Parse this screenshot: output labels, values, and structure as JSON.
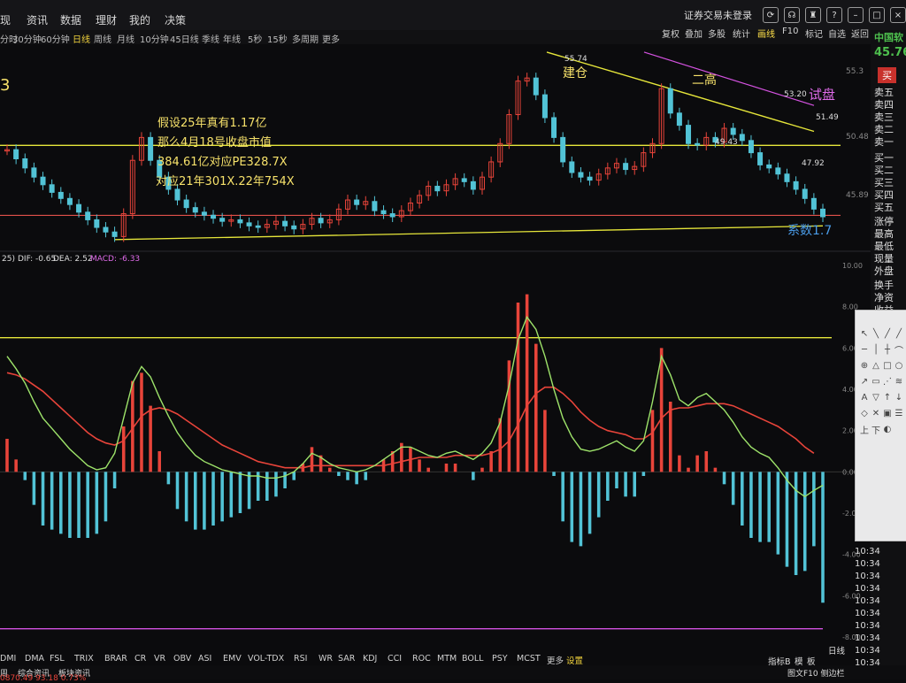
{
  "top_menu": [
    "现",
    "资讯",
    "数据",
    "理财",
    "我的",
    "决策"
  ],
  "top_right": {
    "login": "证券交易未登录",
    "icons": [
      "refresh-icon",
      "headset-icon",
      "shirt-icon",
      "help-icon",
      "minimize-icon",
      "restore-icon",
      "close-icon"
    ]
  },
  "periods": [
    "分时",
    "30分钟",
    "60分钟",
    "日线",
    "周线",
    "月线",
    "10分钟",
    "45日线",
    "季线",
    "年线",
    "5秒",
    "15秒",
    "多周期",
    "更多"
  ],
  "active_period": "日线",
  "right_tools": [
    "复权",
    "叠加",
    "多股",
    "统计",
    "画线",
    "F10",
    "标记",
    "自选",
    "返回"
  ],
  "right_tools_active": "画线",
  "stock": {
    "name": "中国软",
    "price": "45.76",
    "buy_label": "买"
  },
  "order_book": [
    "卖五",
    "卖四",
    "卖三",
    "卖二",
    "卖一",
    "买一",
    "买二",
    "买三",
    "买四",
    "买五"
  ],
  "quote_fields": [
    "涨停",
    "最高",
    "最低",
    "现量",
    "外盘",
    "换手",
    "净资",
    "收益"
  ],
  "price_axis": [
    "55.3",
    "50.48",
    "45.89"
  ],
  "macd_axis": [
    "10.00",
    "8.00",
    "6.00",
    "4.00",
    "2.00",
    "0.00",
    "-2.00",
    "-4.00",
    "-6.00",
    "-8.00"
  ],
  "macd_header": {
    "param": "25)",
    "dif": "DIF: -0.65",
    "dea": "DEA: 2.52",
    "macd": "MACD: -6.33"
  },
  "annotations": {
    "left_number": "3",
    "block": [
      "假设25年真有1.17亿",
      "那么4月18号收盘市值",
      "384.61亿对应PE328.7X",
      "对应21年301X.22年754X"
    ],
    "jiancang": "建仓",
    "ergao": "二高",
    "shipan": "试盘",
    "xishu": "系数1.7",
    "price_peak": "55.74",
    "price_5320": "53.20",
    "price_5149": "51.49",
    "price_4792": "47.92",
    "price_4943": "49.43"
  },
  "chart_data": {
    "type": "line",
    "title": "",
    "candles_close": [
      50.2,
      49.6,
      49.0,
      48.4,
      47.9,
      47.4,
      47.0,
      46.6,
      46.1,
      45.6,
      45.1,
      44.8,
      44.5,
      46.0,
      49.5,
      51.0,
      49.5,
      48.4,
      47.6,
      46.9,
      46.4,
      46.1,
      45.9,
      45.7,
      45.5,
      45.6,
      45.4,
      45.2,
      45.1,
      45.3,
      45.5,
      45.2,
      45.0,
      45.3,
      45.7,
      45.4,
      45.6,
      46.3,
      46.9,
      46.6,
      46.8,
      46.2,
      46.0,
      45.8,
      46.2,
      46.7,
      47.2,
      47.8,
      47.5,
      47.9,
      48.3,
      48.1,
      47.6,
      48.4,
      49.4,
      50.6,
      52.5,
      54.7,
      54.9,
      53.8,
      52.3,
      51.0,
      49.4,
      48.7,
      48.4,
      48.2,
      48.6,
      49.0,
      49.3,
      48.9,
      49.1,
      50.0,
      50.6,
      54.2,
      52.6,
      51.8,
      50.6,
      50.5,
      51.0,
      50.7,
      51.6,
      51.2,
      50.8,
      50.0,
      49.2,
      49.0,
      48.6,
      48.1,
      47.6,
      47.0,
      46.3,
      45.8
    ],
    "macd_dif": [
      5.6,
      5.0,
      4.3,
      3.4,
      2.6,
      2.1,
      1.6,
      1.1,
      0.7,
      0.3,
      0.1,
      0.2,
      0.9,
      2.6,
      4.3,
      5.1,
      4.6,
      3.6,
      2.7,
      1.9,
      1.3,
      0.8,
      0.5,
      0.3,
      0.1,
      0.0,
      -0.1,
      -0.2,
      -0.2,
      -0.3,
      -0.3,
      -0.2,
      0.0,
      0.4,
      0.9,
      0.7,
      0.4,
      0.2,
      0.1,
      0.0,
      0.1,
      0.3,
      0.6,
      0.9,
      1.2,
      1.2,
      1.0,
      0.8,
      0.7,
      0.9,
      1.0,
      0.8,
      0.6,
      0.9,
      1.4,
      2.4,
      4.2,
      6.4,
      7.5,
      6.9,
      5.6,
      4.0,
      2.6,
      1.7,
      1.1,
      1.0,
      1.1,
      1.3,
      1.5,
      1.2,
      1.0,
      1.5,
      3.4,
      5.6,
      4.7,
      3.5,
      3.2,
      3.6,
      3.8,
      3.4,
      3.0,
      2.4,
      1.7,
      1.2,
      0.9,
      0.7,
      0.2,
      -0.4,
      -0.9,
      -1.2,
      -0.9,
      -0.65
    ],
    "macd_dea": [
      4.8,
      4.7,
      4.5,
      4.2,
      3.9,
      3.5,
      3.1,
      2.7,
      2.3,
      1.9,
      1.6,
      1.4,
      1.3,
      1.5,
      2.1,
      2.7,
      3.0,
      3.1,
      3.0,
      2.8,
      2.5,
      2.2,
      1.9,
      1.6,
      1.3,
      1.1,
      0.9,
      0.7,
      0.5,
      0.4,
      0.3,
      0.2,
      0.2,
      0.2,
      0.3,
      0.3,
      0.3,
      0.3,
      0.3,
      0.3,
      0.3,
      0.3,
      0.3,
      0.4,
      0.5,
      0.6,
      0.7,
      0.7,
      0.7,
      0.7,
      0.8,
      0.8,
      0.8,
      0.8,
      0.9,
      1.1,
      1.5,
      2.3,
      3.2,
      3.8,
      4.1,
      4.1,
      3.8,
      3.4,
      2.9,
      2.5,
      2.2,
      2.0,
      1.9,
      1.8,
      1.6,
      1.6,
      1.9,
      2.6,
      3.0,
      3.1,
      3.1,
      3.2,
      3.3,
      3.3,
      3.3,
      3.2,
      3.0,
      2.8,
      2.6,
      2.4,
      2.2,
      1.9,
      1.6,
      1.2,
      0.9,
      2.52
    ],
    "ylim_price": [
      44,
      57
    ],
    "ylim_macd": [
      -8,
      10
    ]
  },
  "indicators": [
    "DMI",
    "DMA",
    "FSL",
    "TRIX",
    "BRAR",
    "CR",
    "VR",
    "OBV",
    "ASI",
    "EMV",
    "VOL-TDX",
    "RSI",
    "WR",
    "SAR",
    "KDJ",
    "CCI",
    "ROC",
    "MTM",
    "BOLL",
    "PSY",
    "MCST",
    "更多",
    "设置"
  ],
  "bottom_right": [
    "指标B",
    "模",
    "板",
    "日线"
  ],
  "bottom_tabs": [
    "周",
    "综合资讯",
    "板块资讯"
  ],
  "bottom_ticker": "0870.49  93.18  0.73%",
  "bottom_right2": "图文F10  侧边栏",
  "times": [
    "10:34",
    "10:34",
    "10:34",
    "10:34",
    "10:34",
    "10:34",
    "10:34",
    "10:34",
    "10:34",
    "10:34"
  ],
  "colors": {
    "bg": "#0b0b0d",
    "up": "#e8443a",
    "down": "#52c3d6",
    "yellow": "#e6e63a",
    "magenta": "#d452e0",
    "red_line": "#e0504a",
    "dif": "#9ee36a",
    "dea": "#e8443a"
  }
}
